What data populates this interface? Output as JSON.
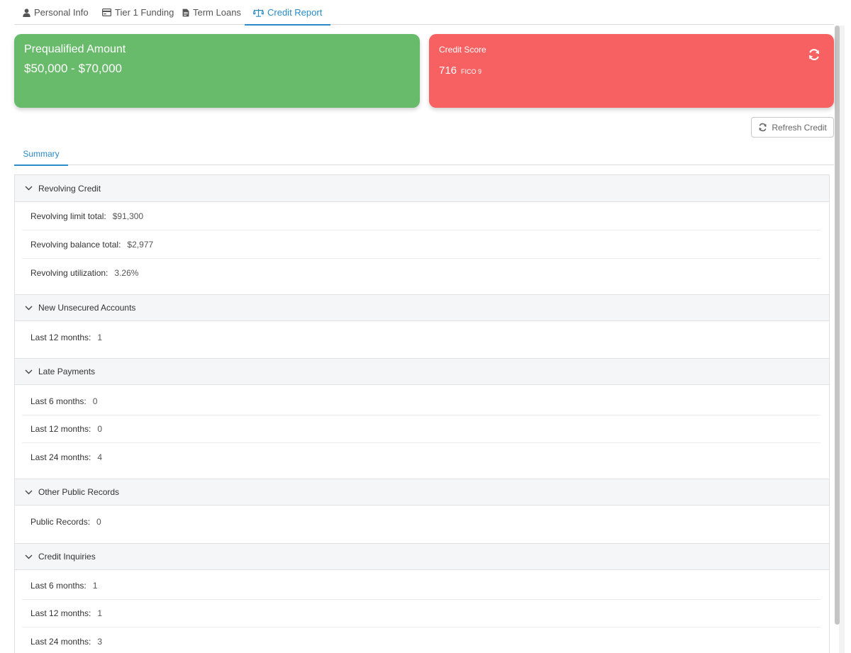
{
  "top_tabs": [
    {
      "label": "Personal Info",
      "icon": "user-icon"
    },
    {
      "label": "Tier 1 Funding",
      "icon": "credit-card-icon"
    },
    {
      "label": "Term Loans",
      "icon": "document-icon"
    },
    {
      "label": "Credit Report",
      "icon": "balance-scale-icon"
    }
  ],
  "prequal": {
    "title": "Prequalified Amount",
    "value": "$50,000 - $70,000"
  },
  "credit_score": {
    "title": "Credit Score",
    "score": "716",
    "model": "FICO 9"
  },
  "refresh_button": {
    "label": "Refresh Credit"
  },
  "sub_tabs": [
    {
      "label": "Summary"
    }
  ],
  "sections": [
    {
      "title": "Revolving Credit",
      "rows": [
        {
          "label": "Revolving limit total:",
          "value": "$91,300"
        },
        {
          "label": "Revolving balance total:",
          "value": "$2,977"
        },
        {
          "label": "Revolving utilization:",
          "value": "3.26%"
        }
      ]
    },
    {
      "title": "New Unsecured Accounts",
      "rows": [
        {
          "label": "Last 12 months:",
          "value": "1"
        }
      ]
    },
    {
      "title": "Late Payments",
      "rows": [
        {
          "label": "Last 6 months:",
          "value": "0"
        },
        {
          "label": "Last 12 months:",
          "value": "0"
        },
        {
          "label": "Last 24 months:",
          "value": "4"
        }
      ]
    },
    {
      "title": "Other Public Records",
      "rows": [
        {
          "label": "Public Records:",
          "value": "0"
        }
      ]
    },
    {
      "title": "Credit Inquiries",
      "rows": [
        {
          "label": "Last 6 months:",
          "value": "1"
        },
        {
          "label": "Last 12 months:",
          "value": "1"
        },
        {
          "label": "Last 24 months:",
          "value": "3"
        }
      ]
    }
  ],
  "colors": {
    "accent": "#2a8bc6",
    "prequal_card": "#68bb6b",
    "credit_score_card": "#f86161",
    "section_header_bg": "#f5f6f7"
  }
}
